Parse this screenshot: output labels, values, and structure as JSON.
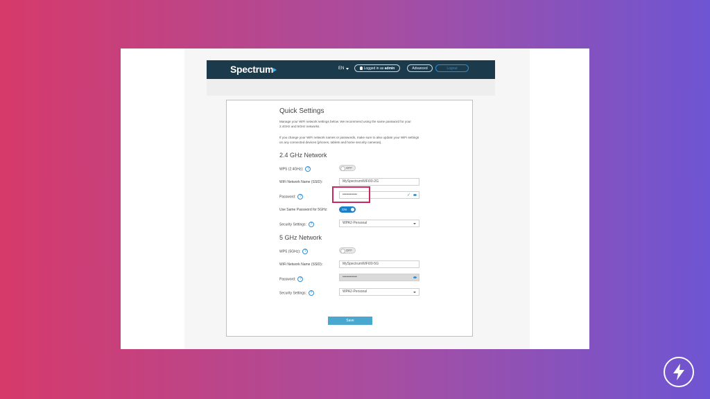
{
  "header": {
    "logo": "Spectrum",
    "language": "EN",
    "logged_in_prefix": "Logged in as",
    "logged_in_user": "admin",
    "advanced_label": "Advanced",
    "logout_label": "Logout"
  },
  "quick_settings": {
    "title": "Quick Settings",
    "intro": "Manage your WiFi network settings below. We recommend using the same password for your 2.4GHz and 5GHz networks.",
    "warning": "If you change your WiFi network names or passwords, make sure to also update your WiFi settings on any connected devices (phones, tablets and home security cameras)."
  },
  "network_24": {
    "heading": "2.4 GHz Network",
    "wps_label": "WPS (2.4GHz):",
    "wps_state": "OFF",
    "ssid_label": "WiFi Network Name (SSID):",
    "ssid_value": "MySpectrumWiFi00-2G",
    "password_label": "Password:",
    "password_value": "••••••••••••",
    "same_password_label": "Use Same Password for 5GHz:",
    "same_password_state": "ON",
    "security_label": "Security Settings:",
    "security_value": "WPA2-Personal"
  },
  "network_5": {
    "heading": "5 GHz Network",
    "wps_label": "WPS (5GHz):",
    "wps_state": "OFF",
    "ssid_label": "WiFi Network Name (SSID):",
    "ssid_value": "MySpectrumWiFi00-5G",
    "password_label": "Password:",
    "password_value": "••••••••••••",
    "security_label": "Security Settings:",
    "security_value": "WPA2-Personal"
  },
  "save_label": "Save",
  "help_glyph": "?",
  "colors": {
    "brand_navy": "#1b3a4c",
    "accent_blue": "#2a8ed8",
    "highlight": "#c8285e",
    "save_button": "#4aa8d0"
  }
}
